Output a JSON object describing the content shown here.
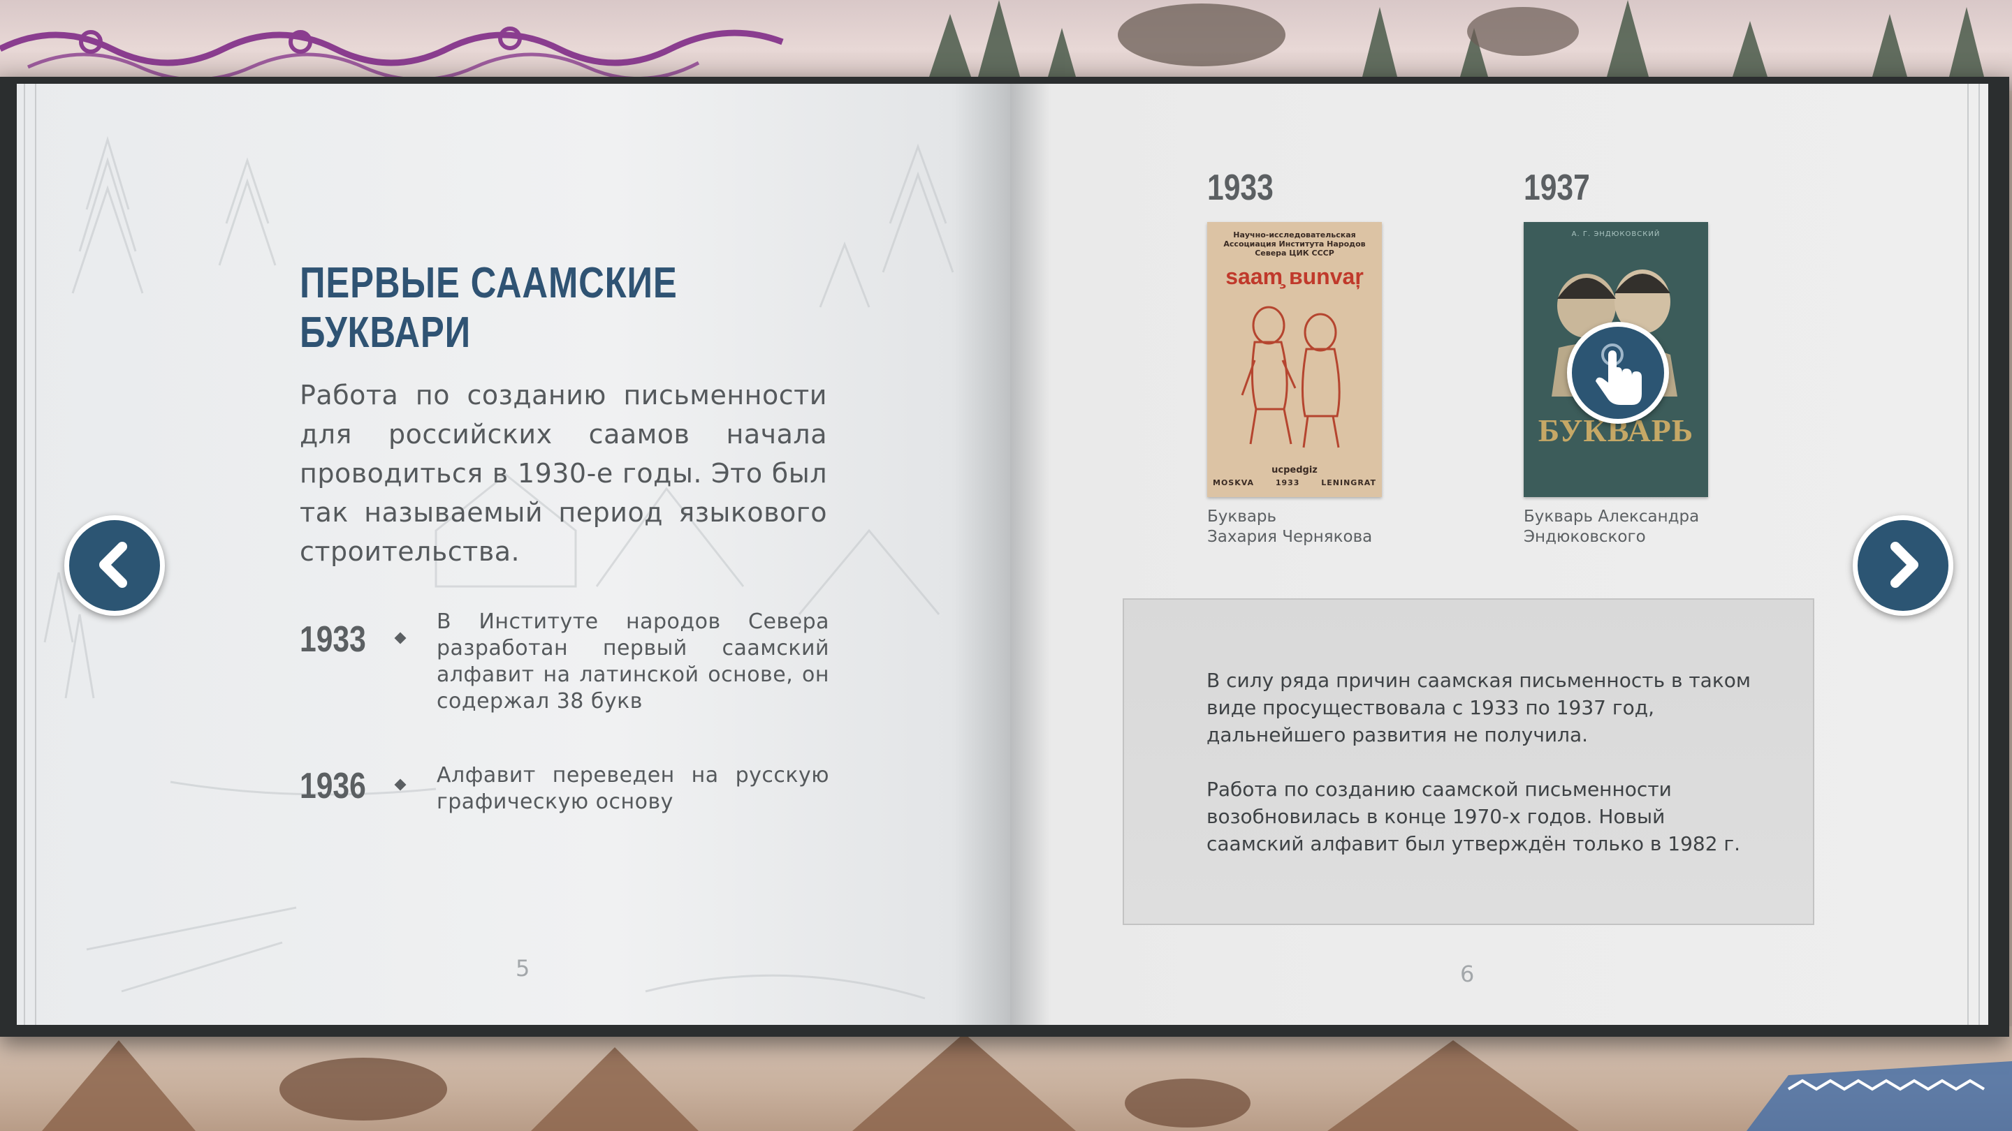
{
  "left_page": {
    "title": "Первые саамские буквари",
    "intro": "Работа по созданию письменности для российских саамов начала проводиться в 1930-е годы. Это был так называемый период языкового строительства.",
    "timeline": [
      {
        "year": "1933",
        "text": "В Институте народов Севера разработан первый саамский алфавит на латинской основе, он содержал 38 букв"
      },
      {
        "year": "1936",
        "text": "Алфавит переведен на русскую графическую основу"
      }
    ],
    "page_number": "5"
  },
  "right_page": {
    "books": [
      {
        "year": "1933",
        "caption_line1": "Букварь",
        "caption_line2": "Захария Чернякова",
        "cover_header": "Научно-исследовательская Ассоциация Института Народов Севера ЦИК СССР",
        "cover_title": "saam̧ вunvaŗ",
        "cover_publisher": "ucpedgiz",
        "cover_city_left": "MOSKVA",
        "cover_cover_year": "1933",
        "cover_city_right": "LENINGRAT"
      },
      {
        "year": "1937",
        "caption_line1": "Букварь Александра",
        "caption_line2": "Эндюковского",
        "cover_author": "А. Г. ЭНДЮКОВСКИЙ",
        "cover_title": "БУКВАРЬ"
      }
    ],
    "info_paragraphs": [
      "В силу ряда причин саамская письменность в таком виде просуществовала с 1933 по 1937 год, дальнейшего развития не получила.",
      "Работа по созданию саамской письменности возобновилась в конце 1970-х годов. Новый саамский алфавит был утверждён только в 1982 г."
    ],
    "page_number": "6"
  },
  "navigation": {
    "prev_icon": "chevron-left-icon",
    "next_icon": "chevron-right-icon",
    "touch_icon": "hand-pointer-icon"
  },
  "colors": {
    "accent": "#2c5573",
    "title": "#2f5373",
    "text": "#55595c"
  }
}
